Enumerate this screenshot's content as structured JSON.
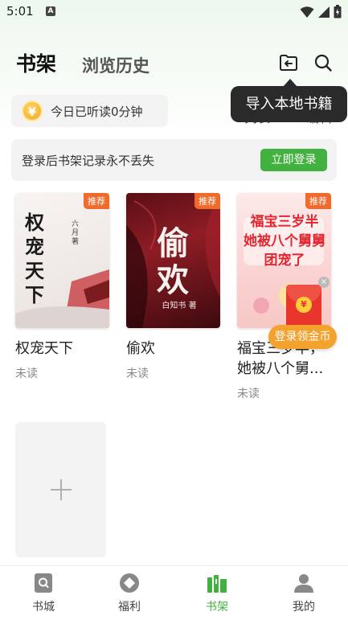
{
  "status_bar": {
    "time": "5:01",
    "badge": "A"
  },
  "header": {
    "tab_shelf": "书架",
    "tab_history": "浏览历史",
    "import_icon": "import-file-icon",
    "search_icon": "search-icon"
  },
  "tooltip": {
    "text": "导入本地书籍"
  },
  "listen": {
    "coin_symbol": "¥",
    "text": "今日已听读0分钟"
  },
  "view": {
    "list_label": "列表",
    "edit_label": "编辑"
  },
  "login_banner": {
    "text": "登录后书架记录永不丢失",
    "button": "立即登录"
  },
  "books": [
    {
      "title": "权宠天下",
      "status": "未读",
      "tag": "推荐",
      "cover_text": "权宠天下",
      "cover_author": "六月 著"
    },
    {
      "title": "偷欢",
      "status": "未读",
      "tag": "推荐",
      "cover_text": "偷欢",
      "cover_author": "白知书 著"
    },
    {
      "title": "福宝三岁半，她被八个舅...",
      "status": "未读",
      "tag": "推荐",
      "cover_text": "福宝三岁半 她被八个舅舅团宠了"
    }
  ],
  "red_packet": {
    "label": "登录领金币",
    "close": "×",
    "coin": "¥"
  },
  "bottom_nav": [
    {
      "label": "书城",
      "icon": "bookstore-icon",
      "active": false
    },
    {
      "label": "福利",
      "icon": "welfare-icon",
      "active": false
    },
    {
      "label": "书架",
      "icon": "bookshelf-icon",
      "active": true
    },
    {
      "label": "我的",
      "icon": "profile-icon",
      "active": false
    }
  ],
  "colors": {
    "accent": "#43b140",
    "tag": "#f06b2b",
    "tooltip_bg": "#2a2a2a"
  }
}
